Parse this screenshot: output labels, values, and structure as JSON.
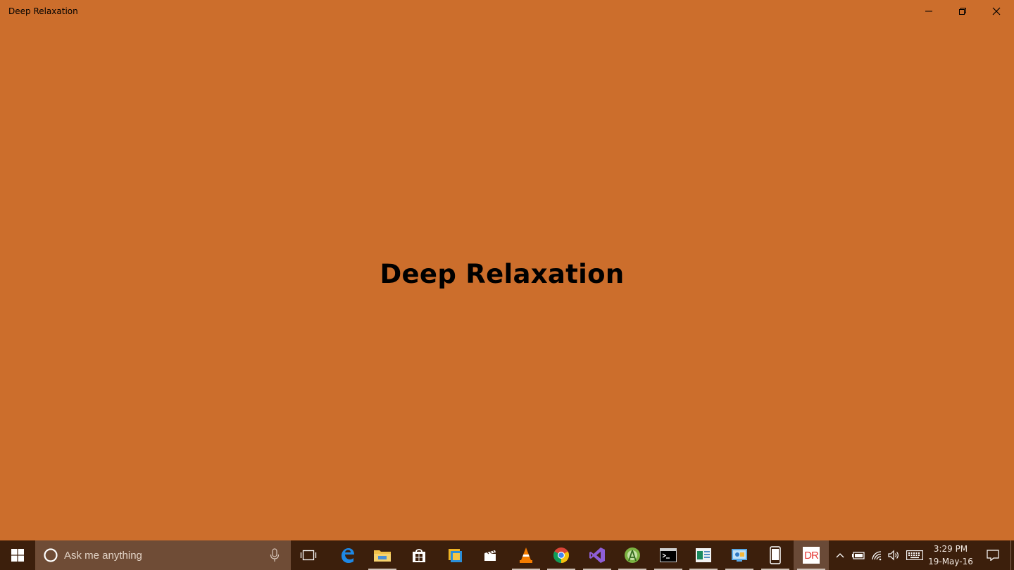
{
  "window": {
    "title": "Deep Relaxation",
    "background": "#cc6e2c"
  },
  "main": {
    "heading": "Deep Relaxation"
  },
  "taskbar": {
    "background": "#3c1f0c",
    "search": {
      "placeholder": "Ask me anything"
    },
    "apps": [
      {
        "icon": "task-view-icon"
      },
      {
        "icon": "edge-icon"
      },
      {
        "icon": "file-explorer-icon",
        "running": true
      },
      {
        "icon": "store-icon"
      },
      {
        "icon": "photo-app-icon"
      },
      {
        "icon": "movies-tv-icon"
      },
      {
        "icon": "vlc-icon",
        "running": true
      },
      {
        "icon": "chrome-icon",
        "running": true
      },
      {
        "icon": "visual-studio-icon",
        "running": true
      },
      {
        "icon": "android-studio-icon",
        "running": true
      },
      {
        "icon": "command-prompt-icon",
        "running": true
      },
      {
        "icon": "reader-app-icon",
        "running": true
      },
      {
        "icon": "control-panel-icon",
        "running": true
      },
      {
        "icon": "phone-emulator-icon",
        "running": true
      },
      {
        "label": "DR",
        "icon": "deep-relaxation-app-icon",
        "active": true
      }
    ],
    "clock": {
      "time": "3:29 PM",
      "date": "19-May-16"
    }
  }
}
